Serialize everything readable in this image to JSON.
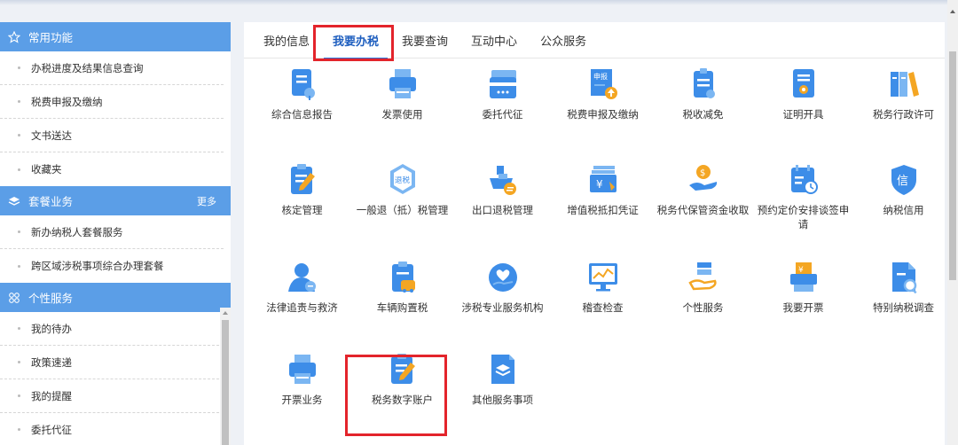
{
  "sidebar": {
    "sections": [
      {
        "title": "常用功能",
        "icon": "star-icon",
        "items": [
          "办税进度及结果信息查询",
          "税费申报及缴纳",
          "文书送达",
          "收藏夹"
        ]
      },
      {
        "title": "套餐业务",
        "icon": "layers-icon",
        "more": "更多",
        "items": [
          "新办纳税人套餐服务",
          "跨区域涉税事项综合办理套餐"
        ]
      },
      {
        "title": "个性服务",
        "icon": "grid-icon",
        "items": [
          "我的待办",
          "政策速递",
          "我的提醒",
          "委托代征"
        ]
      }
    ]
  },
  "main": {
    "tabs": [
      "我的信息",
      "我要办税",
      "我要查询",
      "互动中心",
      "公众服务"
    ],
    "active_tab": "我要办税",
    "rows": [
      [
        {
          "label": "综合信息报告",
          "icon": "report-icon"
        },
        {
          "label": "发票使用",
          "icon": "printer-icon"
        },
        {
          "label": "委托代征",
          "icon": "card-icon"
        },
        {
          "label": "税费申报及缴纳",
          "icon": "declare-upload-icon"
        },
        {
          "label": "税收减免",
          "icon": "tax-reduction-icon"
        },
        {
          "label": "证明开具",
          "icon": "certificate-icon"
        },
        {
          "label": "税务行政许可",
          "icon": "binders-icon"
        }
      ],
      [
        {
          "label": "核定管理",
          "icon": "edit-clipboard-icon"
        },
        {
          "label": "一般退（抵）税管理",
          "icon": "refund-icon"
        },
        {
          "label": "出口退税管理",
          "icon": "ship-icon"
        },
        {
          "label": "增值税抵扣凭证",
          "icon": "yen-voucher-icon"
        },
        {
          "label": "税务代保管资金收取",
          "icon": "hand-money-icon"
        },
        {
          "label": "预约定价安排谈签申请",
          "icon": "calendar-clock-icon"
        },
        {
          "label": "纳税信用",
          "icon": "credit-shield-icon"
        }
      ],
      [
        {
          "label": "法律追责与救济",
          "icon": "legal-person-icon"
        },
        {
          "label": "车辆购置税",
          "icon": "vehicle-tax-icon"
        },
        {
          "label": "涉税专业服务机构",
          "icon": "heart-hand-icon"
        },
        {
          "label": "稽查检查",
          "icon": "monitor-chart-icon"
        },
        {
          "label": "个性服务",
          "icon": "personal-service-icon"
        },
        {
          "label": "我要开票",
          "icon": "invoice-register-icon"
        },
        {
          "label": "特别纳税调查",
          "icon": "search-document-icon"
        }
      ],
      [
        {
          "label": "开票业务",
          "icon": "printer-icon"
        },
        {
          "label": "税务数字账户",
          "icon": "edit-clipboard-icon"
        },
        {
          "label": "其他服务事项",
          "icon": "layers-book-icon"
        }
      ]
    ]
  },
  "colors": {
    "accent": "#5b9ee7",
    "icon": "#3d8de8",
    "highlight": "#e3242b",
    "active_tab": "#1f5fbf"
  }
}
